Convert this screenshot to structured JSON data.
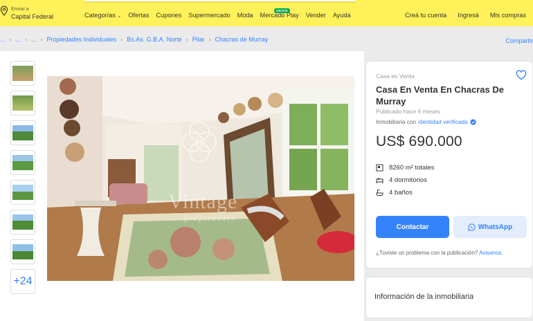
{
  "header": {
    "location_label": "Enviar a",
    "location_value": "Capital Federal",
    "nav": [
      "Categorías",
      "Ofertas",
      "Cupones",
      "Supermercado",
      "Moda",
      "Mercado Play",
      "Vender",
      "Ayuda"
    ],
    "mercado_play_badge": "GRATIS",
    "account": [
      "Creá tu cuenta",
      "Ingresá",
      "Mis compras"
    ]
  },
  "breadcrumb": {
    "items": [
      "...",
      "...",
      "...",
      "Propiedades Individuales",
      "Bs.As. G.B.A. Norte",
      "Pilar",
      "Chacras de Murray"
    ],
    "share": "Compartir"
  },
  "gallery": {
    "more_count": "+24",
    "watermark_line1": "Vintage",
    "watermark_line2": "propiedades"
  },
  "listing": {
    "condition": "Casa en Venta",
    "title": "Casa En Venta En Chacras De Murray",
    "published": "Publicado hace 6 meses",
    "agency_prefix": "Inmobiliaria con",
    "agency_verified": "identidad verificada",
    "price": "US$ 690.000",
    "attributes": [
      {
        "icon": "area-icon",
        "text": "8260 m² totales"
      },
      {
        "icon": "bed-icon",
        "text": "4 dormitorios"
      },
      {
        "icon": "bath-icon",
        "text": "4 baños"
      }
    ],
    "contact_label": "Contactar",
    "whatsapp_label": "WhatsApp",
    "report_text": "¿Tuviste un problema con la publicación?",
    "report_link": "Avisanos."
  },
  "agency_card": {
    "title": "Información de la inmobiliaria"
  },
  "colors": {
    "brand_yellow": "#fff159",
    "accent_blue": "#3483fa",
    "badge_green": "#00a650"
  }
}
